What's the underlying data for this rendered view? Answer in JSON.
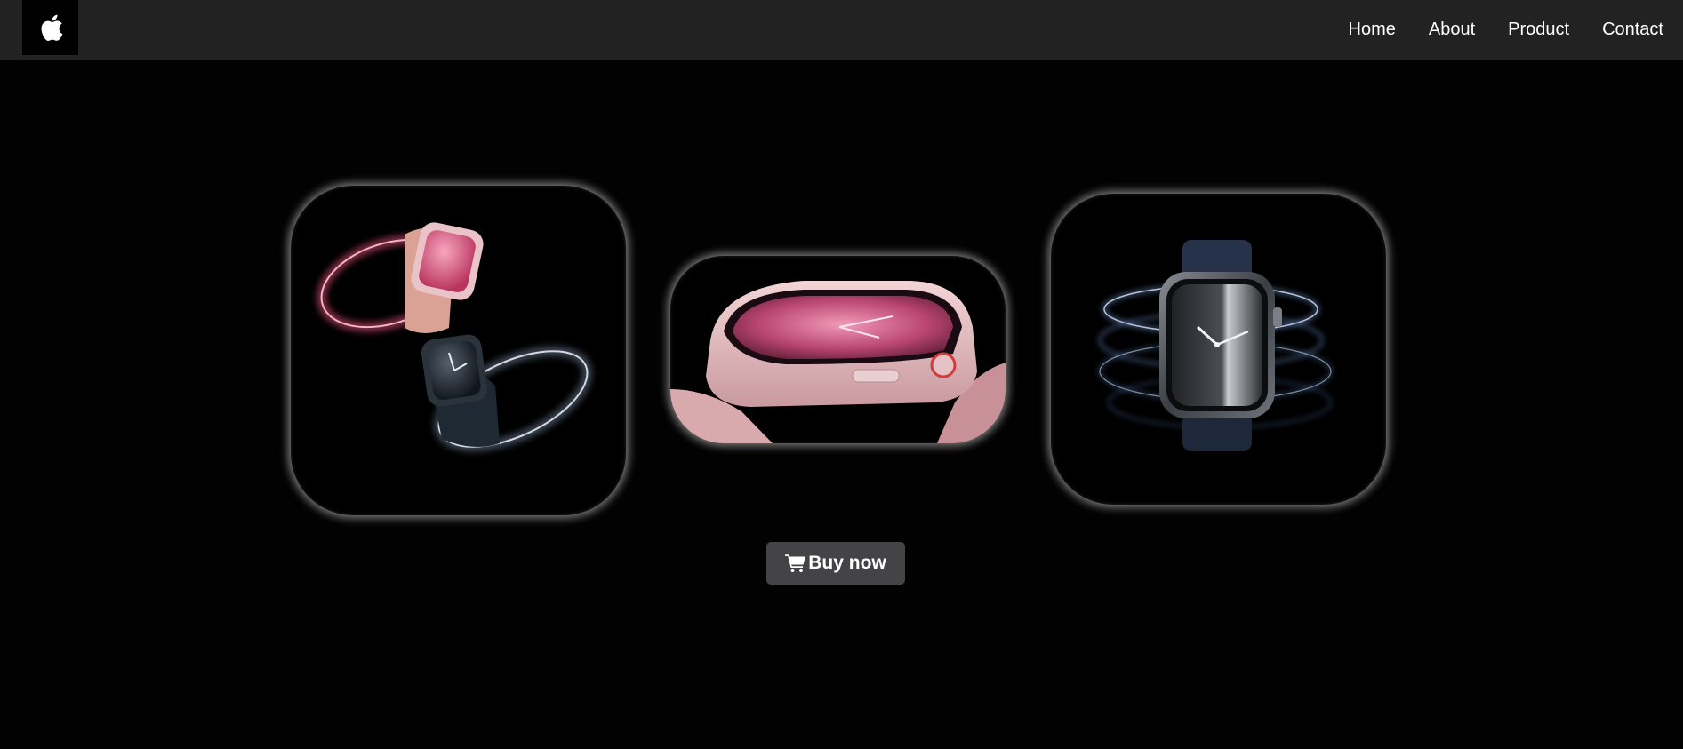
{
  "navbar": {
    "logo_icon": "apple-logo-icon",
    "links": [
      {
        "label": "Home"
      },
      {
        "label": "About"
      },
      {
        "label": "Product"
      },
      {
        "label": "Contact"
      }
    ]
  },
  "products": [
    {
      "name": "watch-pair-pink-midnight",
      "accent": "#e27a9a"
    },
    {
      "name": "watch-pink-closeup",
      "accent": "#e8b4c0"
    },
    {
      "name": "watch-graphite",
      "accent": "#9fc3ff"
    }
  ],
  "cta": {
    "icon": "cart-icon",
    "label": "Buy now",
    "background": "#444446"
  },
  "colors": {
    "page_background": "#020202",
    "navbar_background": "#232222",
    "text": "#ffffff"
  }
}
